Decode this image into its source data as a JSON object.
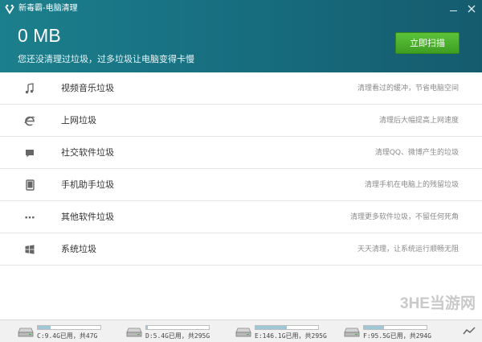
{
  "window": {
    "title": "新毒霸-电脑清理"
  },
  "summary": {
    "size": "0 MB",
    "subtitle": "您还没清理过垃圾，过多垃圾让电脑变得卡慢",
    "scan_label": "立即扫描"
  },
  "items": [
    {
      "icon": "music-note-icon",
      "title": "视频音乐垃圾",
      "desc": "清理看过的缓冲，节省电脑空间"
    },
    {
      "icon": "browser-icon",
      "title": "上网垃圾",
      "desc": "清理后大幅提高上网速度"
    },
    {
      "icon": "chat-bubble-icon",
      "title": "社交软件垃圾",
      "desc": "清理QQ、微博产生的垃圾"
    },
    {
      "icon": "phone-icon",
      "title": "手机助手垃圾",
      "desc": "清理手机在电脑上的残留垃圾"
    },
    {
      "icon": "more-dots-icon",
      "title": "其他软件垃圾",
      "desc": "清理更多软件垃圾，不留任何死角"
    },
    {
      "icon": "windows-icon",
      "title": "系统垃圾",
      "desc": "天天清理，让系统运行顺畅无阻"
    }
  ],
  "watermark": "3HE当游网",
  "drives": [
    {
      "text": "C:9.4G已用，共47G",
      "fill": 0.2
    },
    {
      "text": "D:5.4G已用，共295G",
      "fill": 0.02
    },
    {
      "text": "E:146.1G已用，共295G",
      "fill": 0.5
    },
    {
      "text": "F:95.5G已用，共294G",
      "fill": 0.32
    }
  ],
  "colors": {
    "header": "#176f80",
    "scan_button": "#4cae2c"
  }
}
